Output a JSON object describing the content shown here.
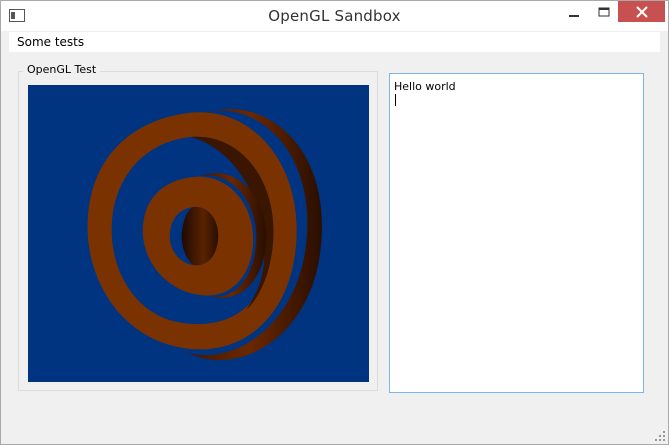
{
  "window": {
    "title": "OpenGL Sandbox",
    "accent": "#c75050"
  },
  "menubar": {
    "items": [
      {
        "label": "Some tests"
      }
    ]
  },
  "groupbox": {
    "title": "OpenGL Test"
  },
  "gl_view": {
    "background": "#003380",
    "object_color": "#7a3300",
    "objects": [
      "outer-ring",
      "inner-ring"
    ]
  },
  "textedit": {
    "text": "Hello world"
  },
  "icons": [
    "app-icon",
    "minimize-icon",
    "maximize-icon",
    "close-icon",
    "size-grip-icon"
  ]
}
